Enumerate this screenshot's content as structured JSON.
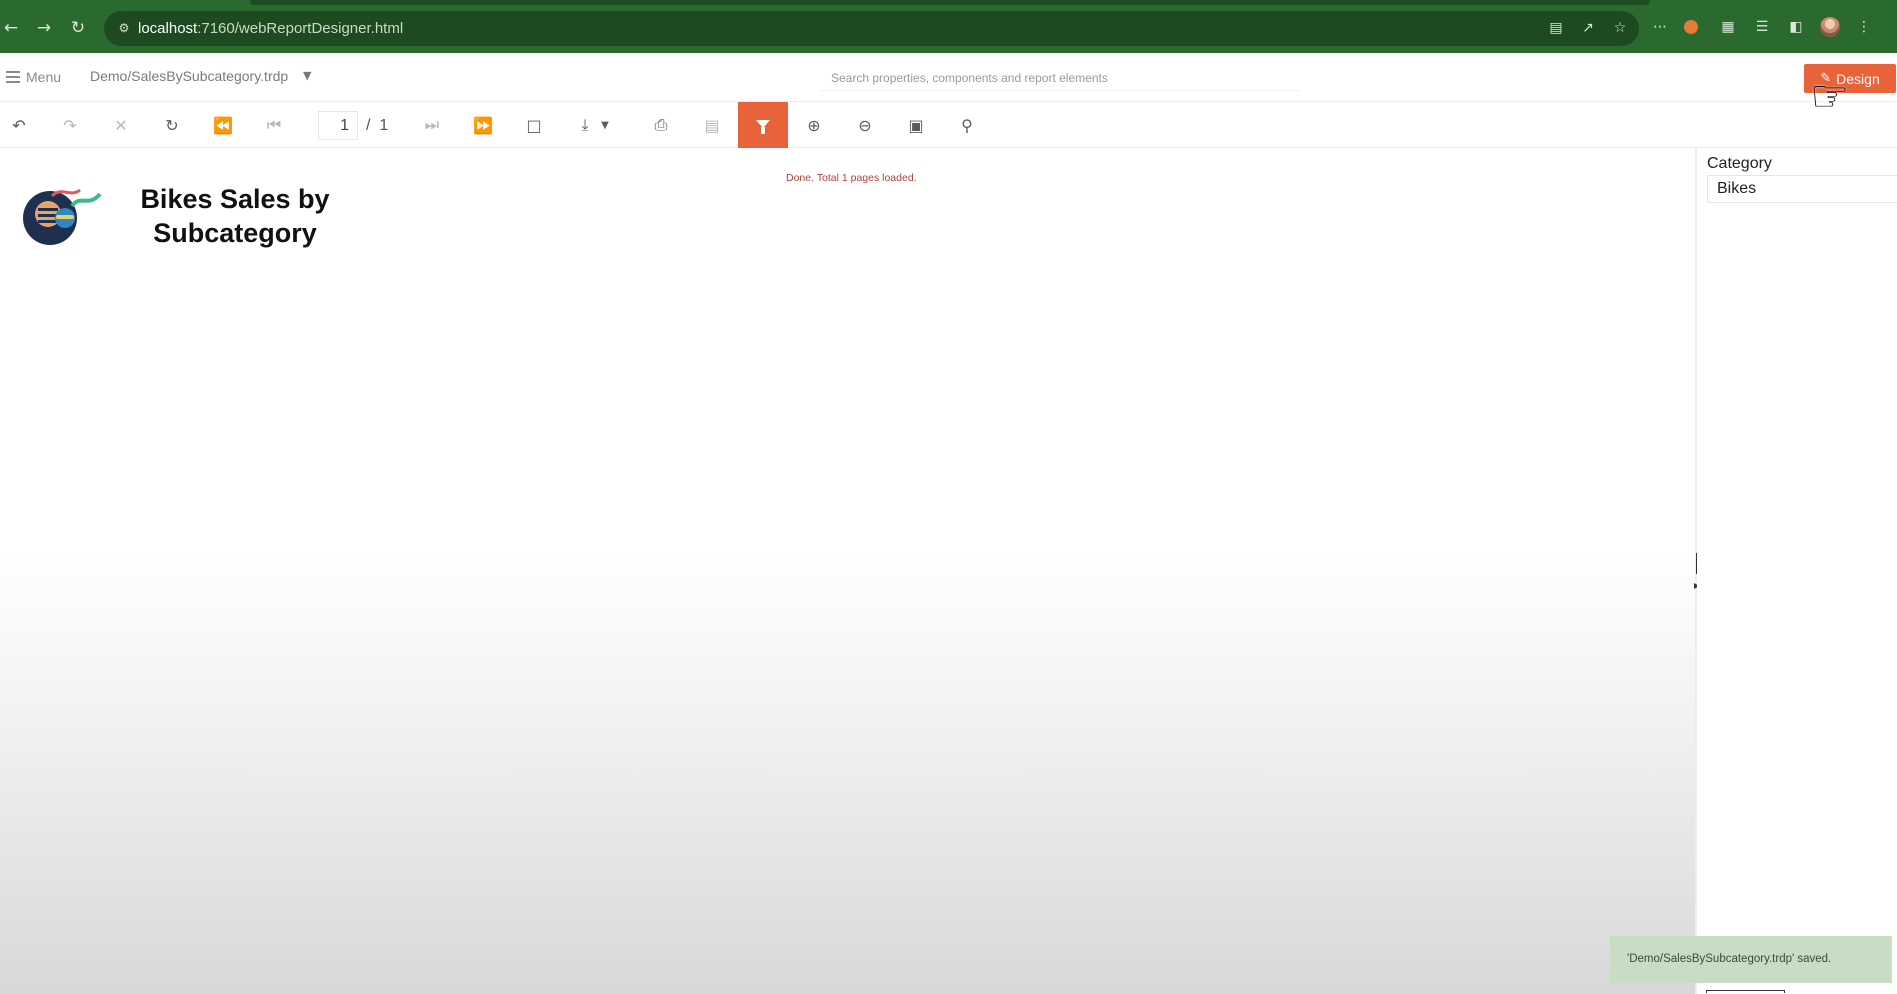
{
  "browser": {
    "url_host": "localhost",
    "url_path": ":7160/webReportDesigner.html",
    "back_icon": "arrow-left-icon",
    "forward_icon": "arrow-right-icon",
    "reload_icon": "reload-icon"
  },
  "appbar": {
    "menu_label": "Menu",
    "report_name": "Demo/SalesBySubcategory.trdp",
    "search_placeholder": "Search properties, components and report elements",
    "design_label": "Design",
    "accent_color": "#e8623a"
  },
  "toolbar": {
    "current_page": "1",
    "page_separator": "/",
    "total_pages": "1",
    "icons": [
      "back-icon",
      "forward-icon",
      "stop-icon",
      "refresh-icon",
      "first-page-icon",
      "previous-page-icon",
      "next-page-icon",
      "last-page-icon",
      "print-preview-icon",
      "export-icon",
      "print-icon",
      "document-map-icon",
      "filter-icon",
      "zoom-in-icon",
      "zoom-out-icon",
      "toggle-zoom-mode-icon",
      "search-icon"
    ],
    "active_tool": "filter-icon"
  },
  "report": {
    "status": "Done. Total 1 pages loaded.",
    "title": "Bikes Sales by Subcategory"
  },
  "parameters": {
    "category_label": "Category",
    "category_value": "Bikes"
  },
  "toast": {
    "message": "'Demo/SalesBySubcategory.trdp' saved."
  }
}
